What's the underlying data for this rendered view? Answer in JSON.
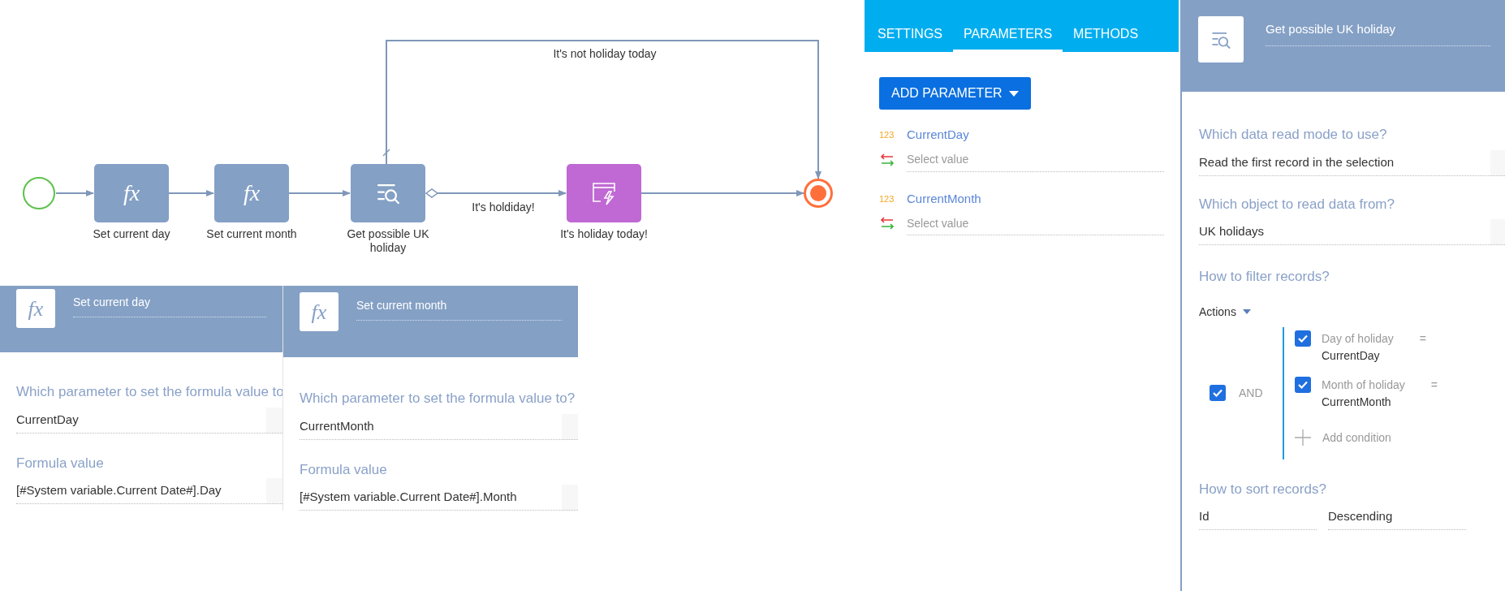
{
  "diagram": {
    "nodes": [
      {
        "kind": "start"
      },
      {
        "kind": "formula",
        "icon_text": "fx",
        "label": "Set current day"
      },
      {
        "kind": "formula",
        "icon_text": "fx",
        "label": "Set current month"
      },
      {
        "kind": "read",
        "label": "Get possible UK holiday"
      },
      {
        "kind": "signal",
        "label": "It's holiday today!"
      },
      {
        "kind": "end"
      }
    ],
    "flows": [
      {
        "label": "It's not holiday today"
      },
      {
        "label": "It's holdiday!"
      }
    ]
  },
  "formula_panels": [
    {
      "icon_text": "fx",
      "title": "Set current day",
      "fields": [
        {
          "label": "Which parameter to set the formula value to",
          "value": "CurrentDay"
        },
        {
          "label": "Formula value",
          "value": "[#System variable.Current Date#].Day"
        }
      ]
    },
    {
      "icon_text": "fx",
      "title": "Set current month",
      "fields": [
        {
          "label": "Which parameter to set the formula value to?",
          "value": "CurrentMonth"
        },
        {
          "label": "Formula value",
          "value": "[#System variable.Current Date#].Month"
        }
      ]
    }
  ],
  "parameters_panel": {
    "tabs": [
      {
        "label": "SETTINGS",
        "selected": false
      },
      {
        "label": "PARAMETERS",
        "selected": true
      },
      {
        "label": "METHODS",
        "selected": false
      }
    ],
    "add_button": "ADD PARAMETER",
    "parameters": [
      {
        "type": "123",
        "name": "CurrentDay",
        "placeholder": "Select value"
      },
      {
        "type": "123",
        "name": "CurrentMonth",
        "placeholder": "Select value"
      }
    ]
  },
  "read_panel": {
    "title": "Get possible UK holiday",
    "fields": [
      {
        "label": "Which data read mode to use?",
        "value": "Read the first record in the selection"
      },
      {
        "label": "Which object to read data from?",
        "value": "UK holidays"
      }
    ],
    "filter": {
      "label": "How to filter records?",
      "actions": "Actions",
      "group": {
        "checked": true,
        "operator": "AND",
        "add": "Add condition",
        "conditions": [
          {
            "checked": true,
            "column": "Day of holiday",
            "comparison": "=",
            "value": "CurrentDay"
          },
          {
            "checked": true,
            "column": "Month of holiday",
            "comparison": "=",
            "value": "CurrentMonth"
          }
        ]
      }
    },
    "sort": {
      "label": "How to sort records?",
      "column": "Id",
      "direction": "Descending"
    }
  }
}
